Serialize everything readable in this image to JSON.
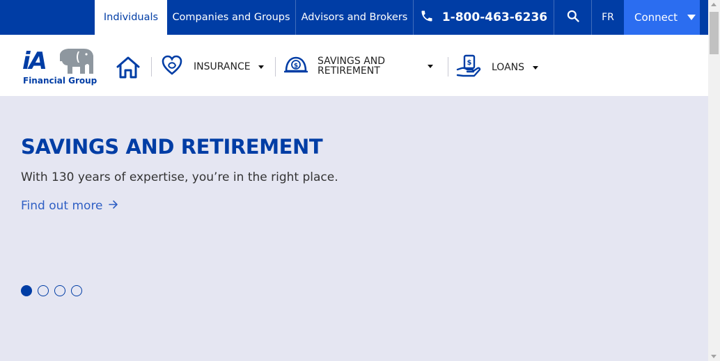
{
  "topbar": {
    "tabs": [
      {
        "label": "Individuals",
        "active": true
      },
      {
        "label": "Companies and Groups",
        "active": false
      },
      {
        "label": "Advisors and Brokers",
        "active": false
      }
    ],
    "phone": "1-800-463-6236",
    "language": "FR",
    "connect": "Connect",
    "icons": {
      "phone": "phone-icon",
      "search": "search-icon",
      "connect_caret": "caret-down-icon"
    }
  },
  "nav": {
    "logo": {
      "mark": "iA",
      "name": "Financial Group"
    },
    "items": [
      {
        "label": "INSURANCE",
        "icon": "heart-icon"
      },
      {
        "label": "SAVINGS AND",
        "label2": "RETIREMENT",
        "icon": "piggy-bank-icon"
      },
      {
        "label": "LOANS",
        "icon": "hand-dollar-icon"
      }
    ],
    "home_icon": "home-icon"
  },
  "hero": {
    "title": "SAVINGS AND RETIREMENT",
    "subtitle": "With 130 years of expertise, you’re in the right place.",
    "cta": "Find out more",
    "slides": 4,
    "active_slide": 1
  },
  "colors": {
    "brand_blue": "#003da5",
    "connect_blue": "#2b6df0",
    "hero_bg": "#e5e6f2",
    "link_blue": "#2f5fc4"
  }
}
